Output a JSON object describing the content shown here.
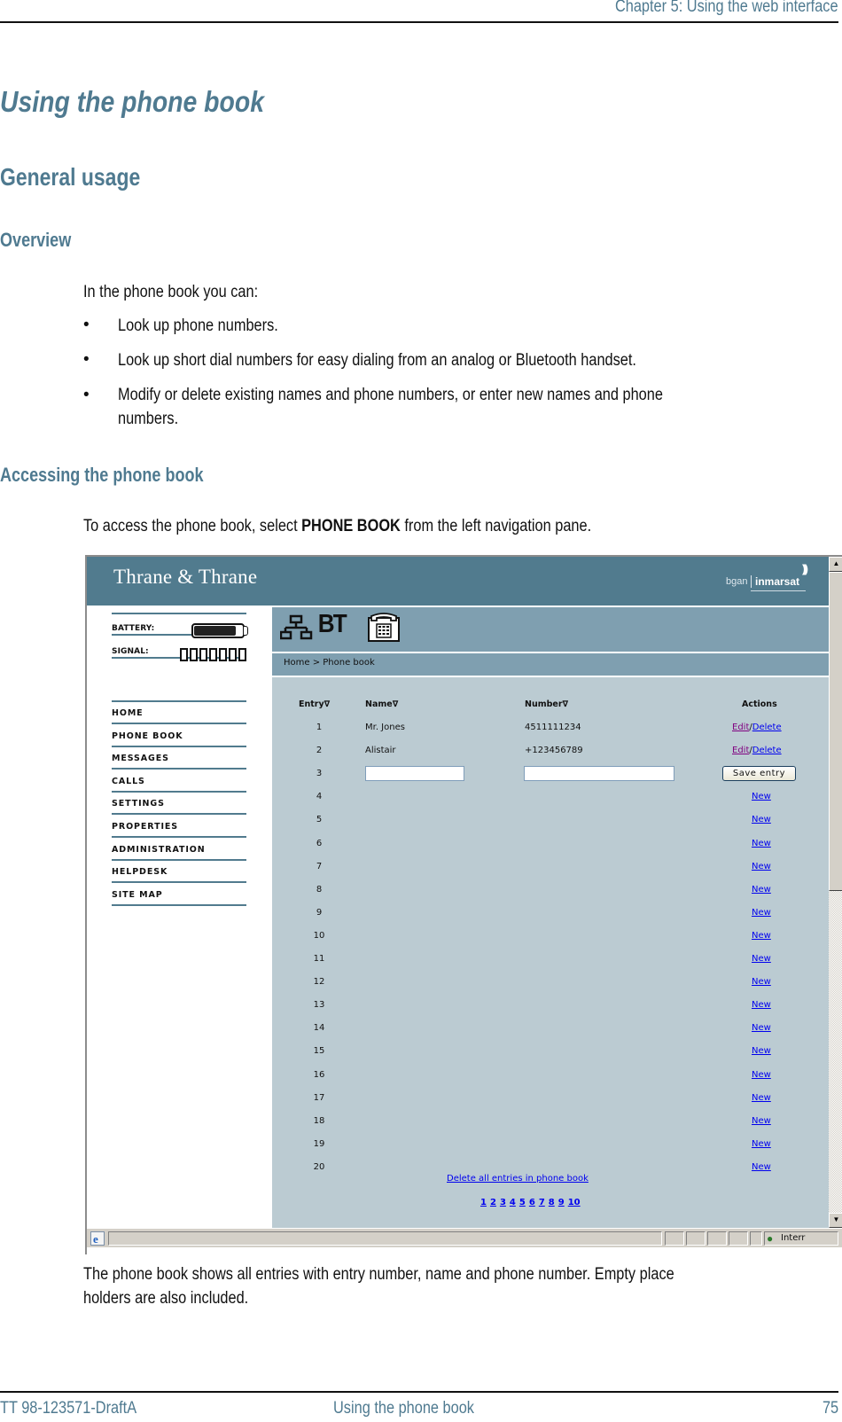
{
  "document": {
    "running_head": "Chapter 5: Using the web interface",
    "title": "Using the phone book",
    "section": "General usage",
    "subsections": {
      "overview": "Overview",
      "accessing": "Accessing the phone book"
    },
    "overview_intro": "In the phone book you can:",
    "bullets": [
      "Look up phone numbers.",
      "Look up short dial numbers for easy dialing from an analog or Bluetooth handset.",
      "Modify or delete existing names and phone numbers, or enter new names and phone",
      "numbers."
    ],
    "access_text_before": "To access the phone book, select ",
    "access_text_bold": "PHONE BOOK",
    "access_text_after": " from the left navigation pane.",
    "caption_line1": "The phone book shows all entries with entry number, name and phone number. Empty place",
    "caption_line2": "holders are also included.",
    "footer": {
      "doc_id": "TT 98-123571-DraftA",
      "section_name": "Using the phone book",
      "page_number": "75"
    }
  },
  "screenshot": {
    "brand": "Thrane & Thrane",
    "partner_logo": {
      "left": "bgan",
      "right": "inmarsat"
    },
    "status": {
      "battery_label": "BATTERY:",
      "battery_level": 0.9,
      "signal_label": "SIGNAL:",
      "signal_bars_total": 7
    },
    "icons": [
      "lan-icon",
      "bluetooth-icon",
      "phone-icon"
    ],
    "bt_label": "BT",
    "breadcrumb": "Home > Phone book",
    "nav": [
      "HOME",
      "PHONE BOOK",
      "MESSAGES",
      "CALLS",
      "SETTINGS",
      "PROPERTIES",
      "ADMINISTRATION",
      "HELPDESK",
      "SITE MAP"
    ],
    "table": {
      "headers": {
        "entry": "Entry∇",
        "name": "Name∇",
        "number": "Number∇",
        "actions": "Actions"
      },
      "rows": [
        {
          "entry": "1",
          "name": "Mr. Jones",
          "number": "4511111234",
          "type": "existing"
        },
        {
          "entry": "2",
          "name": "Alistair",
          "number": "+123456789",
          "type": "existing"
        },
        {
          "entry": "3",
          "name": "",
          "number": "",
          "type": "editing"
        },
        {
          "entry": "4",
          "type": "empty"
        },
        {
          "entry": "5",
          "type": "empty"
        },
        {
          "entry": "6",
          "type": "empty"
        },
        {
          "entry": "7",
          "type": "empty"
        },
        {
          "entry": "8",
          "type": "empty"
        },
        {
          "entry": "9",
          "type": "empty"
        },
        {
          "entry": "10",
          "type": "empty"
        },
        {
          "entry": "11",
          "type": "empty"
        },
        {
          "entry": "12",
          "type": "empty"
        },
        {
          "entry": "13",
          "type": "empty"
        },
        {
          "entry": "14",
          "type": "empty"
        },
        {
          "entry": "15",
          "type": "empty"
        },
        {
          "entry": "16",
          "type": "empty"
        },
        {
          "entry": "17",
          "type": "empty"
        },
        {
          "entry": "18",
          "type": "empty"
        },
        {
          "entry": "19",
          "type": "empty"
        },
        {
          "entry": "20",
          "type": "empty"
        }
      ],
      "edit_label": "Edit",
      "separator": "/",
      "delete_label": "Delete",
      "save_label": "Save entry",
      "new_label": "New"
    },
    "delete_all_label": "Delete all entries in phone book",
    "pages": [
      "1",
      "2",
      "3",
      "4",
      "5",
      "6",
      "7",
      "8",
      "9",
      "10"
    ],
    "statusbar": {
      "zone_text": "Interr"
    }
  },
  "colors": {
    "heading": "#4f7a90",
    "banner": "#517b8e",
    "toolbar": "#7f9fb0",
    "content_bg": "#bbcbd2",
    "link": "#0000ee",
    "visited_link": "#800080"
  }
}
